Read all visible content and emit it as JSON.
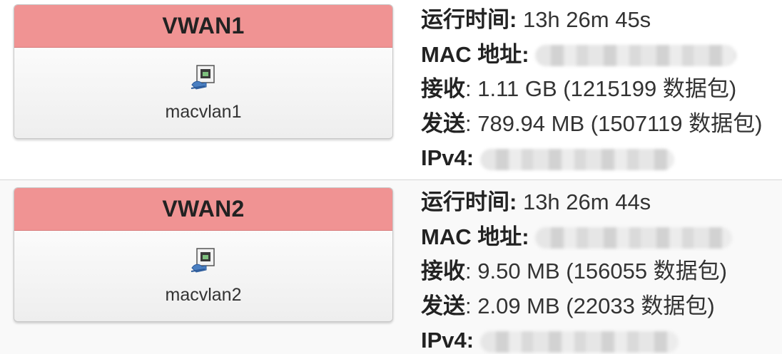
{
  "interfaces": [
    {
      "name": "VWAN1",
      "device": "macvlan1",
      "uptime_label": "运行时间:",
      "uptime": "13h 26m 45s",
      "mac_label": "MAC 地址:",
      "rx_label": "接收",
      "rx": ": 1.11 GB (1215199 数据包)",
      "tx_label": "发送",
      "tx": ": 789.94 MB (1507119 数据包)",
      "ipv4_label": "IPv4:",
      "header_color": "#f09393",
      "icon": "ethernet-port-icon"
    },
    {
      "name": "VWAN2",
      "device": "macvlan2",
      "uptime_label": "运行时间:",
      "uptime": "13h 26m 44s",
      "mac_label": "MAC 地址:",
      "rx_label": "接收",
      "rx": ": 9.50 MB (156055 数据包)",
      "tx_label": "发送",
      "tx": ": 2.09 MB (22033 数据包)",
      "ipv4_label": "IPv4:",
      "header_color": "#f09393",
      "icon": "ethernet-port-icon"
    }
  ]
}
